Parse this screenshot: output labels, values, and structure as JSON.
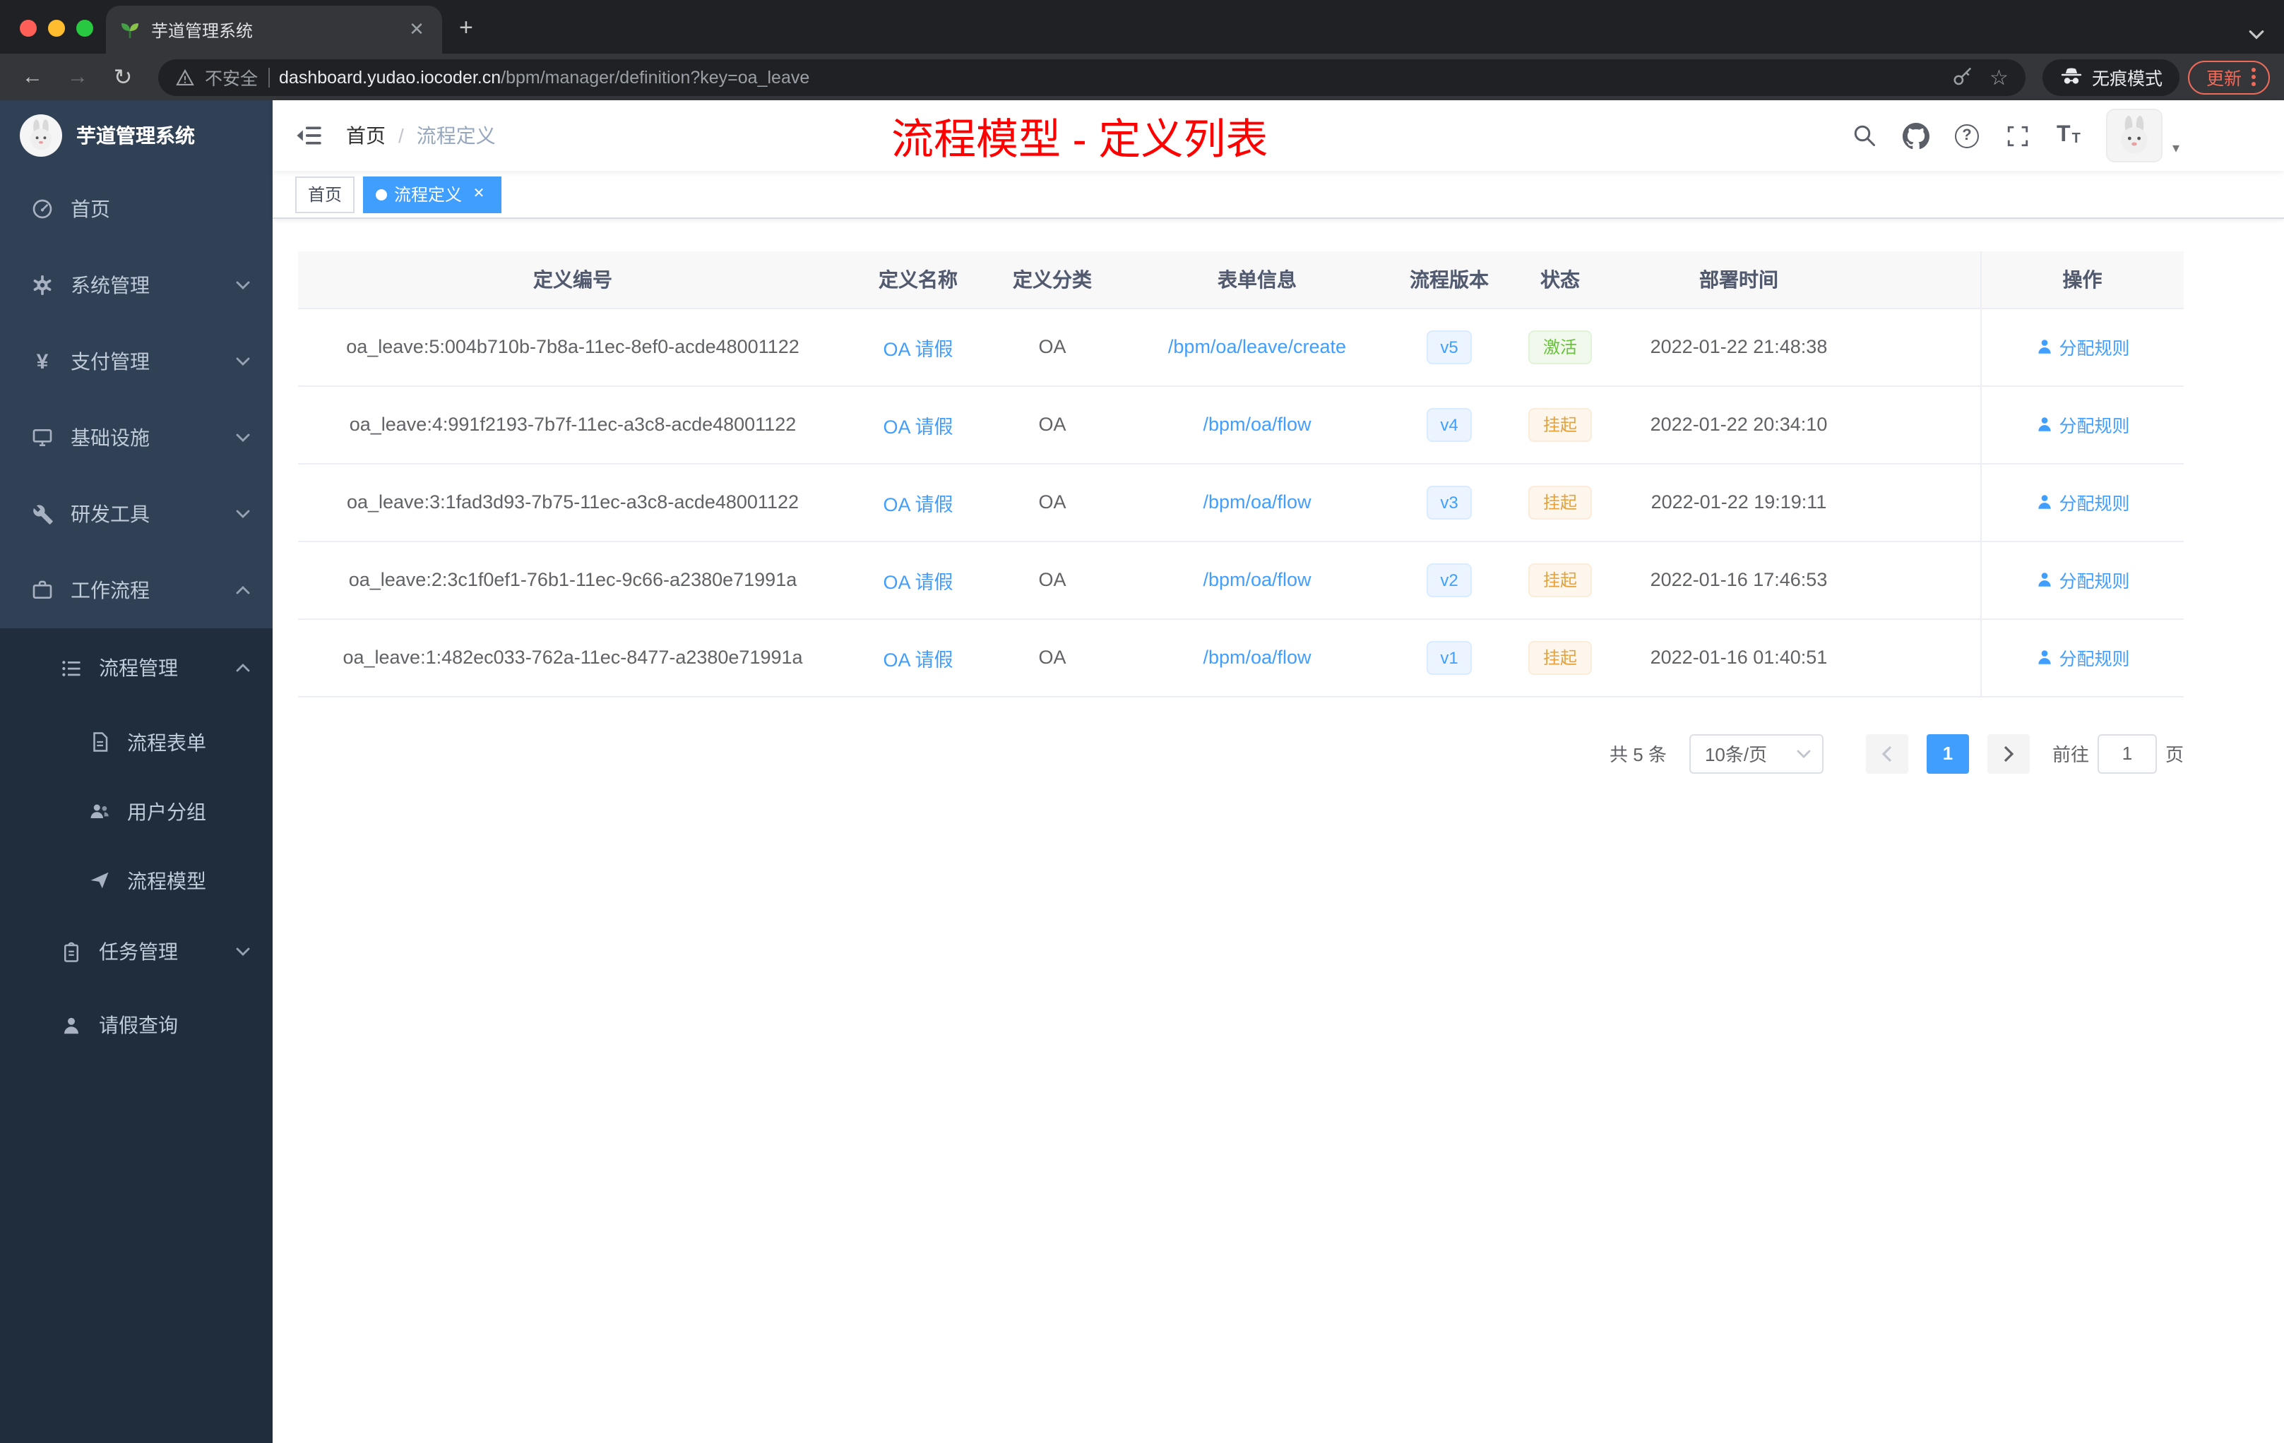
{
  "colors": {
    "primary": "#409eff",
    "success": "#67c23a",
    "warning": "#e6a23c",
    "annotation_red": "#ff0000",
    "sidebar_bg": "#304156",
    "submenu_bg": "#1f2d3d"
  },
  "browser": {
    "tab_title": "芋道管理系统",
    "security_label": "不安全",
    "url_domain": "dashboard.yudao.iocoder.cn",
    "url_path": "/bpm/manager/definition?key=oa_leave",
    "incognito_label": "无痕模式",
    "update_label": "更新"
  },
  "sidebar": {
    "logo_title": "芋道管理系统",
    "items": [
      {
        "label": "首页"
      },
      {
        "label": "系统管理"
      },
      {
        "label": "支付管理"
      },
      {
        "label": "基础设施"
      },
      {
        "label": "研发工具"
      },
      {
        "label": "工作流程"
      }
    ],
    "submenu": {
      "process_mgmt": "流程管理",
      "process_children": [
        {
          "label": "流程表单"
        },
        {
          "label": "用户分组"
        },
        {
          "label": "流程模型"
        }
      ],
      "task_mgmt": "任务管理",
      "leave_query": "请假查询"
    }
  },
  "header": {
    "breadcrumb_home": "首页",
    "breadcrumb_sep": "/",
    "breadcrumb_current": "流程定义",
    "annotation": "流程模型 - 定义列表"
  },
  "tags": {
    "home": "首页",
    "current": "流程定义"
  },
  "table": {
    "columns": {
      "id": "定义编号",
      "name": "定义名称",
      "category": "定义分类",
      "form": "表单信息",
      "version": "流程版本",
      "status": "状态",
      "deploy_time": "部署时间",
      "actions": "操作"
    },
    "rows": [
      {
        "id": "oa_leave:5:004b710b-7b8a-11ec-8ef0-acde48001122",
        "name": "OA 请假",
        "category": "OA",
        "form": "/bpm/oa/leave/create",
        "version": "v5",
        "status": "激活",
        "deploy_time": "2022-01-22 21:48:38",
        "action": "分配规则"
      },
      {
        "id": "oa_leave:4:991f2193-7b7f-11ec-a3c8-acde48001122",
        "name": "OA 请假",
        "category": "OA",
        "form": "/bpm/oa/flow",
        "version": "v4",
        "status": "挂起",
        "deploy_time": "2022-01-22 20:34:10",
        "action": "分配规则"
      },
      {
        "id": "oa_leave:3:1fad3d93-7b75-11ec-a3c8-acde48001122",
        "name": "OA 请假",
        "category": "OA",
        "form": "/bpm/oa/flow",
        "version": "v3",
        "status": "挂起",
        "deploy_time": "2022-01-22 19:19:11",
        "action": "分配规则"
      },
      {
        "id": "oa_leave:2:3c1f0ef1-76b1-11ec-9c66-a2380e71991a",
        "name": "OA 请假",
        "category": "OA",
        "form": "/bpm/oa/flow",
        "version": "v2",
        "status": "挂起",
        "deploy_time": "2022-01-16 17:46:53",
        "action": "分配规则"
      },
      {
        "id": "oa_leave:1:482ec033-762a-11ec-8477-a2380e71991a",
        "name": "OA 请假",
        "category": "OA",
        "form": "/bpm/oa/flow",
        "version": "v1",
        "status": "挂起",
        "deploy_time": "2022-01-16 01:40:51",
        "action": "分配规则"
      }
    ]
  },
  "pagination": {
    "total": "共 5 条",
    "page_size": "10条/页",
    "current_page": "1",
    "goto_label": "前往",
    "goto_value": "1",
    "unit_label": "页"
  }
}
